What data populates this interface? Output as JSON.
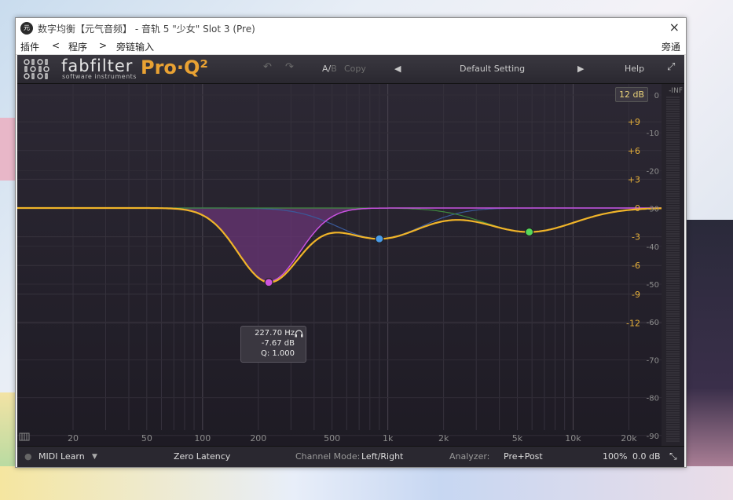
{
  "window": {
    "title": "数字均衡【元气音频】 - 音轨 5 \"少女\" Slot 3 (Pre)",
    "icon_text": "元",
    "close_icon": "×"
  },
  "menu": {
    "plugin": "插件",
    "prev": "<",
    "program": "程序",
    "next": ">",
    "sidechain": "旁链输入",
    "bypass": "旁通"
  },
  "header": {
    "brand": "fabfilter",
    "brand_sub": "software instruments",
    "product": "Pro·Q²",
    "undo_icon": "↶",
    "redo_icon": "↷",
    "ab": "A/",
    "ab_b": "B",
    "copy": "Copy",
    "prev_preset": "◀",
    "preset": "Default Setting",
    "next_preset": "▶",
    "help": "Help",
    "fullscreen_icon": "⤢"
  },
  "display": {
    "range": "12 dB",
    "gain_labels": [
      "+9",
      "+6",
      "+3",
      "0",
      "-3",
      "-6",
      "-9",
      "-12"
    ],
    "gain_values": [
      9,
      6,
      3,
      0,
      -3,
      -6,
      -9,
      -12
    ],
    "meter_top": "-INF",
    "meter_labels": [
      "0",
      "-10",
      "-20",
      "-30",
      "-40",
      "-50",
      "-60",
      "-70",
      "-80",
      "-90"
    ],
    "meter_values": [
      0,
      -10,
      -20,
      -30,
      -40,
      -50,
      -60,
      -70,
      -80,
      -90
    ],
    "freq_labels": [
      "20",
      "50",
      "100",
      "200",
      "500",
      "1k",
      "2k",
      "5k",
      "10k",
      "20k"
    ],
    "freq_values": [
      20,
      50,
      100,
      200,
      500,
      1000,
      2000,
      5000,
      10000,
      20000
    ],
    "piano_icon": "piano-icon"
  },
  "bands": [
    {
      "freq": 227.7,
      "gain": -7.67,
      "color": "#cc55dd"
    },
    {
      "freq": 900,
      "gain": -3.2,
      "color": "#4a9be8"
    },
    {
      "freq": 5800,
      "gain": -2.5,
      "color": "#55d85a"
    }
  ],
  "tooltip": {
    "freq": "227.70 Hz",
    "gain": "-7.67 dB",
    "q": "Q: 1.000",
    "headphone_icon": "headphones-icon"
  },
  "bottom": {
    "midi_learn": "MIDI Learn",
    "midi_dropdown_icon": "▼",
    "latency": "Zero Latency",
    "channel_label": "Channel Mode:",
    "channel_value": "Left/Right",
    "analyzer_label": "Analyzer:",
    "analyzer_value": "Pre+Post",
    "zoom": "100%",
    "output_gain": "0.0 dB",
    "resize_icon": "⤡"
  },
  "colors": {
    "curve": "#f0b429",
    "fill": "#6a3576",
    "label_gain": "#e9b23a",
    "label_meter": "#8c8c8c"
  }
}
